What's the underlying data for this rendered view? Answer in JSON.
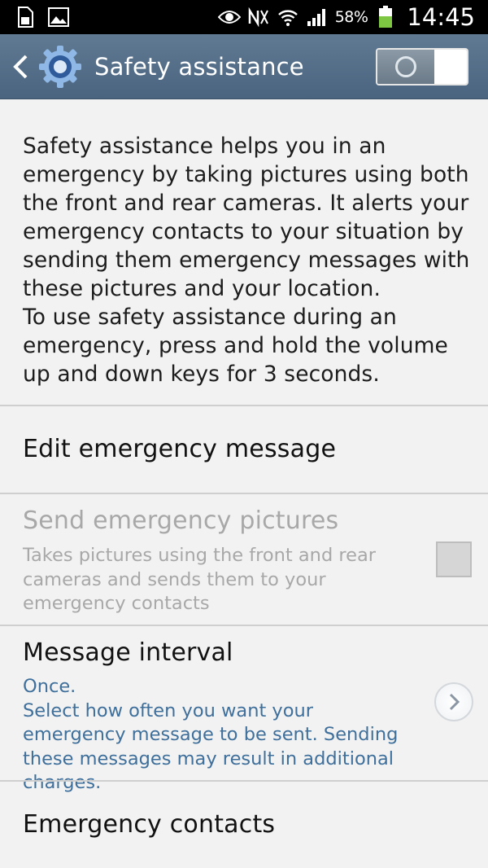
{
  "status_bar": {
    "battery_percent": "58%",
    "time": "14:45",
    "icons": [
      "sd-card-icon",
      "image-icon",
      "eye-icon",
      "nfc-icon",
      "wifi-icon",
      "signal-icon",
      "battery-icon"
    ]
  },
  "action_bar": {
    "title": "Safety assistance",
    "master_switch": "off"
  },
  "description": "Safety assistance helps you in an emergency by taking pictures using both the front and rear cameras. It alerts your emergency contacts to your situation by sending them emergency messages with these pictures and your location.\nTo use safety assistance during an emergency, press and hold the volume up and down keys for 3 seconds.",
  "items": [
    {
      "title": "Edit emergency message"
    },
    {
      "title": "Send emergency pictures",
      "summary": "Takes pictures using the front and rear cameras and sends them to your emergency contacts",
      "enabled": false,
      "checked": false
    },
    {
      "title": "Message interval",
      "summary": "Once.\nSelect how often you want your emergency message to be sent. Sending these messages may result in additional charges."
    },
    {
      "title": "Emergency contacts"
    }
  ],
  "colors": {
    "action_bar": "#546f8a",
    "accent_summary": "#3f6f9b",
    "battery": "#7dc742"
  }
}
